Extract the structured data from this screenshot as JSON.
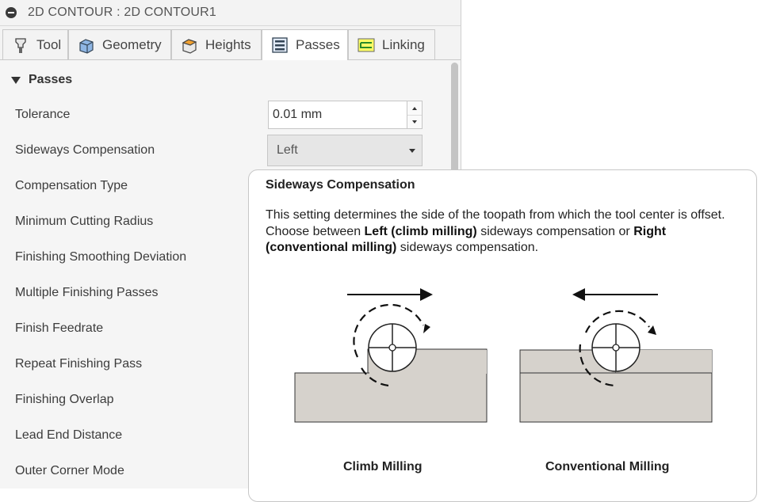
{
  "header": {
    "title": "2D CONTOUR : 2D CONTOUR1"
  },
  "tabs": [
    {
      "label": "Tool",
      "icon": "tool-icon"
    },
    {
      "label": "Geometry",
      "icon": "geometry-icon"
    },
    {
      "label": "Heights",
      "icon": "heights-icon"
    },
    {
      "label": "Passes",
      "icon": "passes-icon",
      "active": true
    },
    {
      "label": "Linking",
      "icon": "linking-icon"
    }
  ],
  "section": {
    "title": "Passes"
  },
  "rows": [
    "Tolerance",
    "Sideways Compensation",
    "Compensation Type",
    "Minimum Cutting Radius",
    "Finishing Smoothing Deviation",
    "Multiple Finishing Passes",
    "Finish Feedrate",
    "Repeat Finishing Pass",
    "Finishing Overlap",
    "Lead End Distance",
    "Outer Corner Mode"
  ],
  "tolerance": {
    "value": "0.01 mm"
  },
  "sideways": {
    "value": "Left"
  },
  "tooltip": {
    "title": "Sideways Compensation",
    "body_1": "This setting determines the side of the toopath from which the tool center is offset. Choose between ",
    "body_bold_1": "Left (climb milling)",
    "body_2": " sideways compensation or ",
    "body_bold_2": "Right (conventional milling)",
    "body_3": " sideways compensation.",
    "caption_left": "Climb Milling",
    "caption_right": "Conventional Milling"
  },
  "colors": {
    "panel": "#f5f5f5",
    "stock": "#d6d2cc",
    "tab_linking_accent": "#e0e000"
  }
}
